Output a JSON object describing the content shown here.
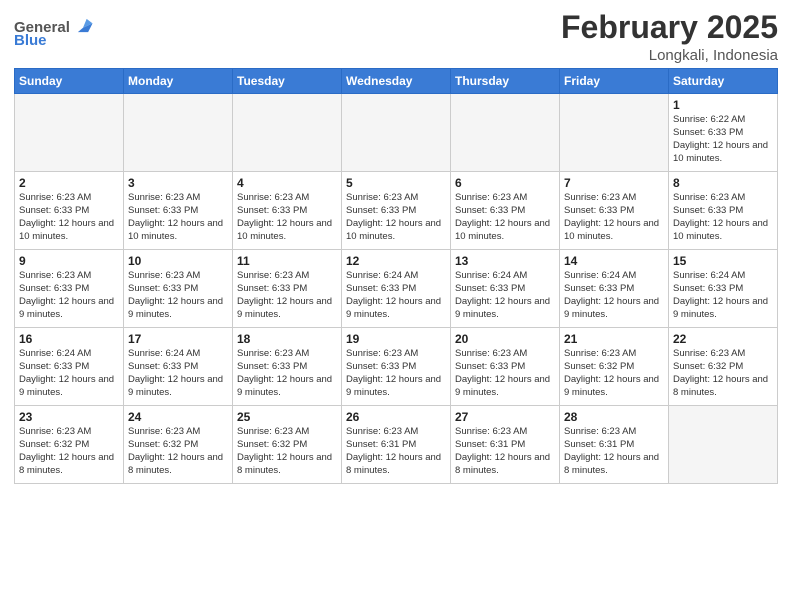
{
  "header": {
    "logo_general": "General",
    "logo_blue": "Blue",
    "month_year": "February 2025",
    "location": "Longkali, Indonesia"
  },
  "days_of_week": [
    "Sunday",
    "Monday",
    "Tuesday",
    "Wednesday",
    "Thursday",
    "Friday",
    "Saturday"
  ],
  "weeks": [
    [
      {
        "day": "",
        "info": ""
      },
      {
        "day": "",
        "info": ""
      },
      {
        "day": "",
        "info": ""
      },
      {
        "day": "",
        "info": ""
      },
      {
        "day": "",
        "info": ""
      },
      {
        "day": "",
        "info": ""
      },
      {
        "day": "1",
        "info": "Sunrise: 6:22 AM\nSunset: 6:33 PM\nDaylight: 12 hours\nand 10 minutes."
      }
    ],
    [
      {
        "day": "2",
        "info": "Sunrise: 6:23 AM\nSunset: 6:33 PM\nDaylight: 12 hours\nand 10 minutes."
      },
      {
        "day": "3",
        "info": "Sunrise: 6:23 AM\nSunset: 6:33 PM\nDaylight: 12 hours\nand 10 minutes."
      },
      {
        "day": "4",
        "info": "Sunrise: 6:23 AM\nSunset: 6:33 PM\nDaylight: 12 hours\nand 10 minutes."
      },
      {
        "day": "5",
        "info": "Sunrise: 6:23 AM\nSunset: 6:33 PM\nDaylight: 12 hours\nand 10 minutes."
      },
      {
        "day": "6",
        "info": "Sunrise: 6:23 AM\nSunset: 6:33 PM\nDaylight: 12 hours\nand 10 minutes."
      },
      {
        "day": "7",
        "info": "Sunrise: 6:23 AM\nSunset: 6:33 PM\nDaylight: 12 hours\nand 10 minutes."
      },
      {
        "day": "8",
        "info": "Sunrise: 6:23 AM\nSunset: 6:33 PM\nDaylight: 12 hours\nand 10 minutes."
      }
    ],
    [
      {
        "day": "9",
        "info": "Sunrise: 6:23 AM\nSunset: 6:33 PM\nDaylight: 12 hours\nand 9 minutes."
      },
      {
        "day": "10",
        "info": "Sunrise: 6:23 AM\nSunset: 6:33 PM\nDaylight: 12 hours\nand 9 minutes."
      },
      {
        "day": "11",
        "info": "Sunrise: 6:23 AM\nSunset: 6:33 PM\nDaylight: 12 hours\nand 9 minutes."
      },
      {
        "day": "12",
        "info": "Sunrise: 6:24 AM\nSunset: 6:33 PM\nDaylight: 12 hours\nand 9 minutes."
      },
      {
        "day": "13",
        "info": "Sunrise: 6:24 AM\nSunset: 6:33 PM\nDaylight: 12 hours\nand 9 minutes."
      },
      {
        "day": "14",
        "info": "Sunrise: 6:24 AM\nSunset: 6:33 PM\nDaylight: 12 hours\nand 9 minutes."
      },
      {
        "day": "15",
        "info": "Sunrise: 6:24 AM\nSunset: 6:33 PM\nDaylight: 12 hours\nand 9 minutes."
      }
    ],
    [
      {
        "day": "16",
        "info": "Sunrise: 6:24 AM\nSunset: 6:33 PM\nDaylight: 12 hours\nand 9 minutes."
      },
      {
        "day": "17",
        "info": "Sunrise: 6:24 AM\nSunset: 6:33 PM\nDaylight: 12 hours\nand 9 minutes."
      },
      {
        "day": "18",
        "info": "Sunrise: 6:23 AM\nSunset: 6:33 PM\nDaylight: 12 hours\nand 9 minutes."
      },
      {
        "day": "19",
        "info": "Sunrise: 6:23 AM\nSunset: 6:33 PM\nDaylight: 12 hours\nand 9 minutes."
      },
      {
        "day": "20",
        "info": "Sunrise: 6:23 AM\nSunset: 6:33 PM\nDaylight: 12 hours\nand 9 minutes."
      },
      {
        "day": "21",
        "info": "Sunrise: 6:23 AM\nSunset: 6:32 PM\nDaylight: 12 hours\nand 9 minutes."
      },
      {
        "day": "22",
        "info": "Sunrise: 6:23 AM\nSunset: 6:32 PM\nDaylight: 12 hours\nand 8 minutes."
      }
    ],
    [
      {
        "day": "23",
        "info": "Sunrise: 6:23 AM\nSunset: 6:32 PM\nDaylight: 12 hours\nand 8 minutes."
      },
      {
        "day": "24",
        "info": "Sunrise: 6:23 AM\nSunset: 6:32 PM\nDaylight: 12 hours\nand 8 minutes."
      },
      {
        "day": "25",
        "info": "Sunrise: 6:23 AM\nSunset: 6:32 PM\nDaylight: 12 hours\nand 8 minutes."
      },
      {
        "day": "26",
        "info": "Sunrise: 6:23 AM\nSunset: 6:31 PM\nDaylight: 12 hours\nand 8 minutes."
      },
      {
        "day": "27",
        "info": "Sunrise: 6:23 AM\nSunset: 6:31 PM\nDaylight: 12 hours\nand 8 minutes."
      },
      {
        "day": "28",
        "info": "Sunrise: 6:23 AM\nSunset: 6:31 PM\nDaylight: 12 hours\nand 8 minutes."
      },
      {
        "day": "",
        "info": ""
      }
    ]
  ]
}
